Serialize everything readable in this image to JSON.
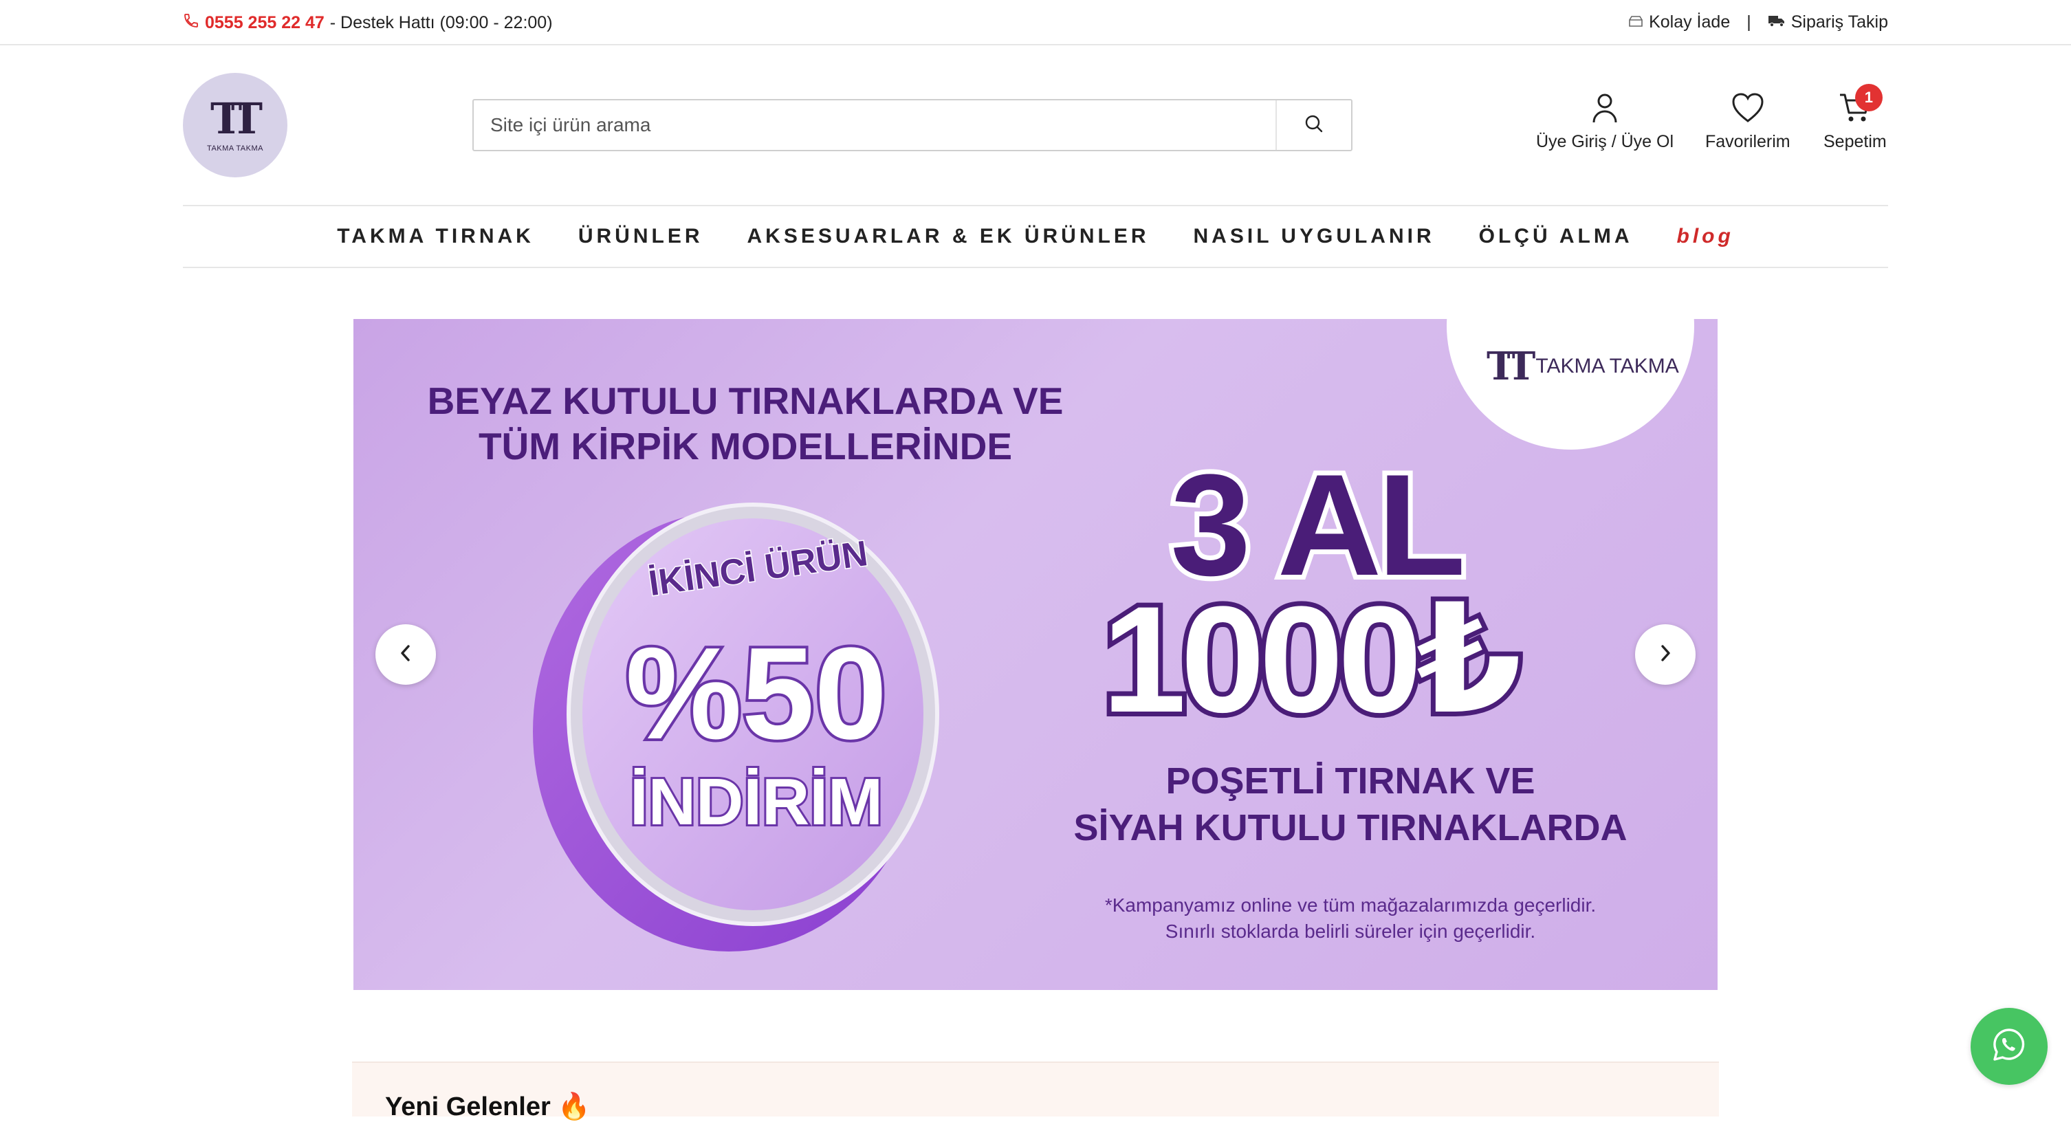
{
  "topbar": {
    "phone": "0555 255 22 47",
    "support": "- Destek Hattı (09:00 - 22:00)",
    "easy_return": "Kolay İade",
    "separator": "|",
    "order_tracking": "Sipariş Takip"
  },
  "header": {
    "logo_mark": "TT",
    "logo_text": "TAKMA TAKMA",
    "search_placeholder": "Site içi ürün arama",
    "login_label": "Üye Giriş / Üye Ol",
    "favorites_label": "Favorilerim",
    "cart_label": "Sepetim",
    "cart_count": "1"
  },
  "nav": {
    "items": [
      "TAKMA TIRNAK",
      "ÜRÜNLER",
      "AKSESUARLAR & EK ÜRÜNLER",
      "NASIL UYGULANIR",
      "ÖLÇÜ ALMA"
    ],
    "blog": "blog"
  },
  "banner": {
    "brand": "TAKMA TAKMA",
    "brand_mark": "TT",
    "headline_1": "BEYAZ KUTULU TIRNAKLARDA VE",
    "headline_2": "TÜM KİRPİK MODELLERİNDE",
    "coin_top": "İKİNCİ ÜRÜN",
    "coin_main": "%50",
    "coin_bottom": "İNDİRİM",
    "offer_1": "3 AL",
    "offer_2": "1000₺",
    "sub_1": "POŞETLİ TIRNAK VE",
    "sub_2": "SİYAH KUTULU TIRNAKLARDA",
    "fine_1": "*Kampanyamız online ve tüm mağazalarımızda geçerlidir.",
    "fine_2": "Sınırlı stoklarda belirli süreler için geçerlidir."
  },
  "section": {
    "new_arrivals": "Yeni Gelenler 🔥"
  },
  "colors": {
    "accent_red": "#e02b2b",
    "banner_purple": "#4a1d78",
    "whatsapp_green": "#47c562"
  }
}
